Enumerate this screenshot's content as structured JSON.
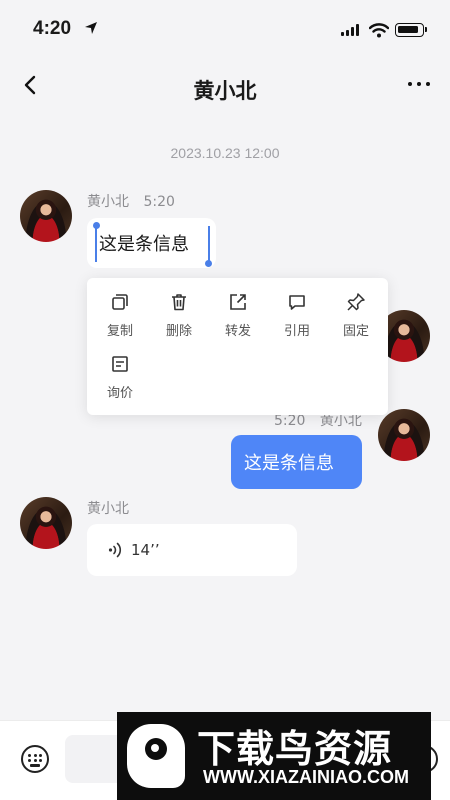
{
  "status_bar": {
    "time": "4:20"
  },
  "nav": {
    "title": "黄小北"
  },
  "chat": {
    "timestamp": "2023.10.23 12:00",
    "messages": [
      {
        "sender": "黄小北",
        "time": "5:20",
        "text": "这是条信息",
        "direction": "incoming",
        "selected": true
      },
      {
        "sender": "黄小北",
        "time": "5:20",
        "text": "这是条信息",
        "direction": "outgoing"
      },
      {
        "sender": "黄小北",
        "type": "voice",
        "duration": "14’’",
        "direction": "incoming"
      }
    ]
  },
  "context_menu": {
    "items": [
      {
        "label": "复制",
        "icon": "copy-icon"
      },
      {
        "label": "删除",
        "icon": "trash-icon"
      },
      {
        "label": "转发",
        "icon": "forward-icon"
      },
      {
        "label": "引用",
        "icon": "quote-icon"
      },
      {
        "label": "固定",
        "icon": "pin-icon"
      },
      {
        "label": "询价",
        "icon": "inquiry-icon"
      }
    ]
  },
  "bottom_bar": {
    "keyboard_icon": "keyboard-icon",
    "emoji_icon": "emoji-icon"
  },
  "watermark": {
    "title": "下载鸟资源",
    "url": "WWW.XIAZAINIAO.COM"
  },
  "colors": {
    "accent": "#4f86f7",
    "selection": "#4a7fe8",
    "background": "#f4f4f6"
  }
}
